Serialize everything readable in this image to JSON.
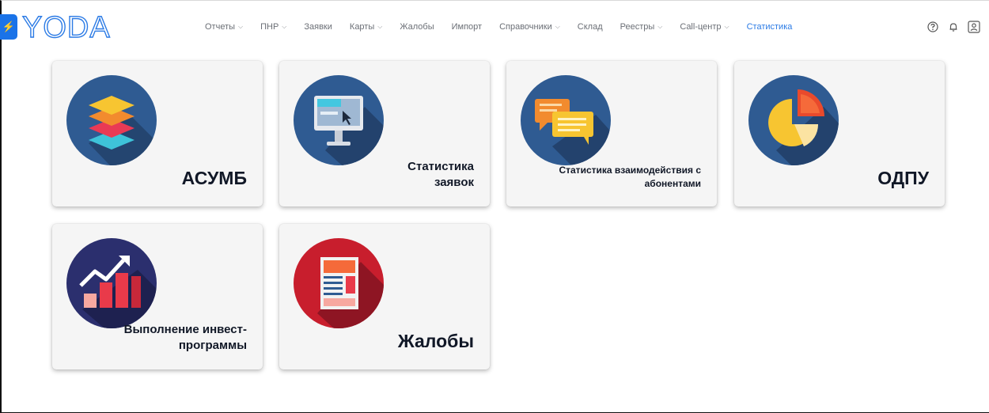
{
  "header": {
    "logo_text": "YODA",
    "nav": [
      {
        "label": "Отчеты",
        "dropdown": true
      },
      {
        "label": "ПНР",
        "dropdown": true
      },
      {
        "label": "Заявки",
        "dropdown": false
      },
      {
        "label": "Карты",
        "dropdown": true
      },
      {
        "label": "Жалобы",
        "dropdown": false
      },
      {
        "label": "Импорт",
        "dropdown": false
      },
      {
        "label": "Справочники",
        "dropdown": true
      },
      {
        "label": "Склад",
        "dropdown": false
      },
      {
        "label": "Реестры",
        "dropdown": true
      },
      {
        "label": "Call-центр",
        "dropdown": true
      },
      {
        "label": "Статистика",
        "dropdown": false,
        "active": true
      }
    ],
    "tools": [
      "help-icon",
      "bell-icon",
      "user-icon"
    ]
  },
  "cards": [
    {
      "id": "asumb",
      "title": "АСУМБ",
      "icon": "layers-icon"
    },
    {
      "id": "requests-stats",
      "title": "Статистика заявок",
      "icon": "monitor-icon"
    },
    {
      "id": "interaction-stats",
      "title": "Статистика взаимодействия с абонентами",
      "icon": "chat-icon"
    },
    {
      "id": "odpu",
      "title": "ОДПУ",
      "icon": "pie-chart-icon"
    },
    {
      "id": "invest",
      "title": "Выполнение инвест-программы",
      "icon": "growth-chart-icon"
    },
    {
      "id": "complaints",
      "title": "Жалобы",
      "icon": "document-icon"
    }
  ],
  "colors": {
    "accent": "#2c7be5",
    "nav_text": "#6b6f76",
    "card_bg": "#f5f5f5",
    "title": "#111827",
    "circle_blue": "#2f5b92",
    "circle_red": "#c81e2d"
  }
}
